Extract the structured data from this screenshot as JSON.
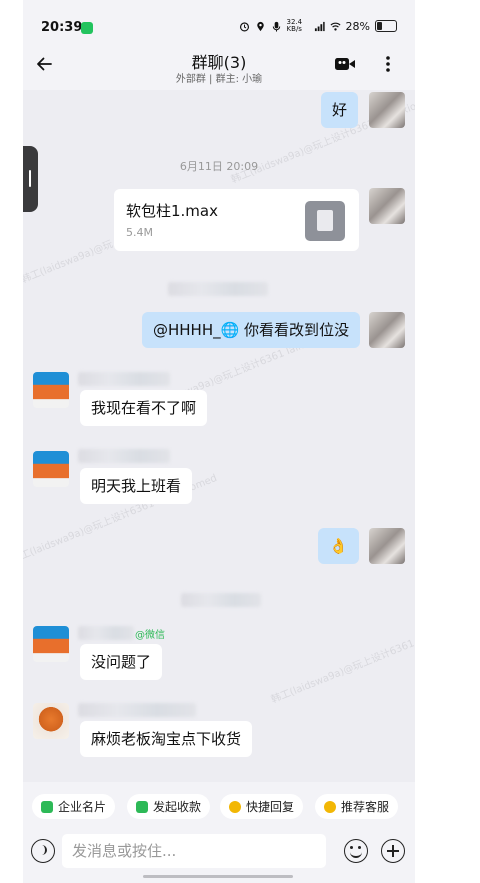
{
  "status": {
    "time": "20:39",
    "network": "32.4 KB/s",
    "battery": "28%"
  },
  "header": {
    "title": "群聊(3)",
    "subtitle": "外部群 | 群主: 小瑜"
  },
  "messages": {
    "m1": "好",
    "timestamp": "6月11日 20:09",
    "file_name": "软包柱1.max",
    "file_size": "5.4M",
    "m3": "@HHHH_🌐 你看看改到位没",
    "m4": "我现在看不了啊",
    "m5": "明天我上班看",
    "m6": "👌",
    "tag": "@微信",
    "m7": "没问题了",
    "m8": "麻烦老板淘宝点下收货"
  },
  "watermark": "韩工(laidswa9a)@玩上设计6361 laimexiomed",
  "quick_actions": [
    "企业名片",
    "发起收款",
    "快捷回复",
    "推荐客服"
  ],
  "input": {
    "placeholder": "发消息或按住..."
  },
  "colors": {
    "bubble_self": "#c7e2fb",
    "bubble_other": "#ffffff",
    "background": "#ededf2"
  }
}
